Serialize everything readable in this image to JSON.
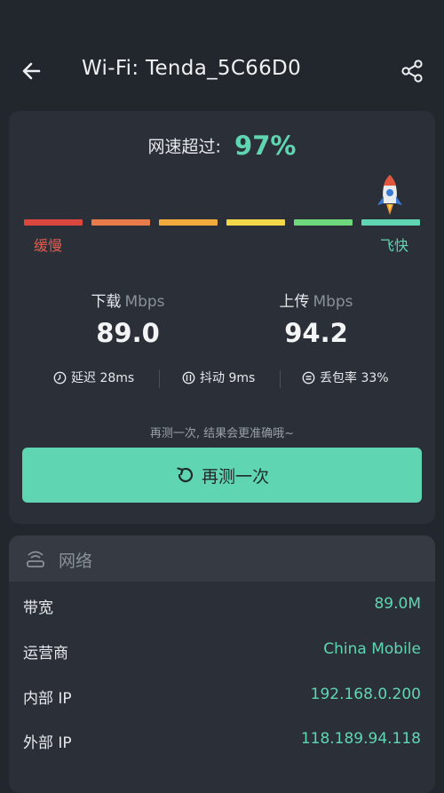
{
  "header": {
    "title": "Wi-Fi: Tenda_5C66D0"
  },
  "speed": {
    "label": "网速超过:",
    "percent": "97%"
  },
  "scale": {
    "slow_label": "缓慢",
    "fast_label": "飞快",
    "colors": [
      "#d9473e",
      "#e77c4a",
      "#f0ab3c",
      "#f3d84a",
      "#6fd87c",
      "#5fd6b1"
    ]
  },
  "download": {
    "name": "下载",
    "unit": "Mbps",
    "value": "89.0"
  },
  "upload": {
    "name": "上传",
    "unit": "Mbps",
    "value": "94.2"
  },
  "stats": {
    "latency": "延迟 28ms",
    "jitter": "抖动 9ms",
    "loss": "丢包率 33%"
  },
  "hint": "再测一次, 结果会更准确哦~",
  "retest_label": "再测一次",
  "network": {
    "title": "网络",
    "rows": [
      {
        "key": "带宽",
        "value": "89.0M"
      },
      {
        "key": "运营商",
        "value": "China Mobile"
      },
      {
        "key": "内部 IP",
        "value": "192.168.0.200"
      },
      {
        "key": "外部 IP",
        "value": "118.189.94.118"
      }
    ]
  },
  "colors": {
    "accent": "#5fd6b1",
    "slow": "#e25b4e",
    "background": "#22262d",
    "card": "#2b3038"
  }
}
